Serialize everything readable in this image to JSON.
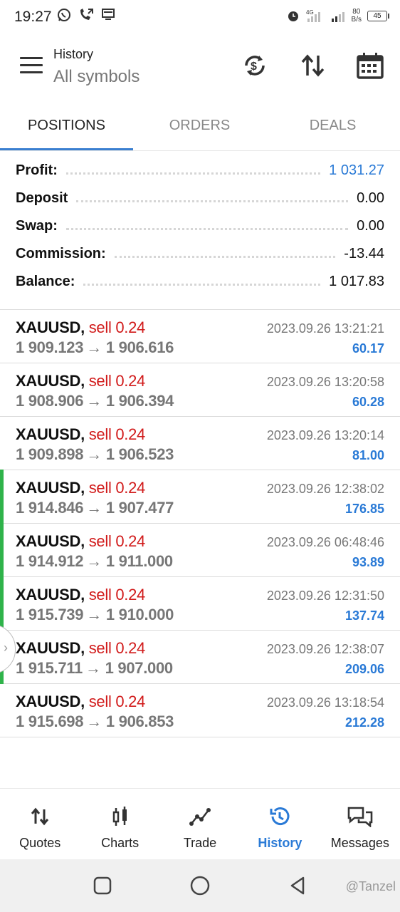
{
  "status_bar": {
    "time": "19:27",
    "net_speed_value": "80",
    "net_speed_unit": "B/s",
    "network": "4G",
    "battery": "45"
  },
  "header": {
    "title": "History",
    "subtitle": "All symbols"
  },
  "tabs": [
    {
      "label": "POSITIONS",
      "active": true
    },
    {
      "label": "ORDERS",
      "active": false
    },
    {
      "label": "DEALS",
      "active": false
    }
  ],
  "summary": {
    "profit_label": "Profit:",
    "profit_value": "1 031.27",
    "deposit_label": "Deposit",
    "deposit_value": "0.00",
    "swap_label": "Swap:",
    "swap_value": "0.00",
    "commission_label": "Commission:",
    "commission_value": "-13.44",
    "balance_label": "Balance:",
    "balance_value": "1 017.83"
  },
  "deals": [
    {
      "symbol": "XAUUSD,",
      "side": "sell 0.24",
      "open_price": "1 909.123",
      "close_price": "1 906.616",
      "time": "2023.09.26 13:21:21",
      "profit": "60.17"
    },
    {
      "symbol": "XAUUSD,",
      "side": "sell 0.24",
      "open_price": "1 908.906",
      "close_price": "1 906.394",
      "time": "2023.09.26 13:20:58",
      "profit": "60.28"
    },
    {
      "symbol": "XAUUSD,",
      "side": "sell 0.24",
      "open_price": "1 909.898",
      "close_price": "1 906.523",
      "time": "2023.09.26 13:20:14",
      "profit": "81.00"
    },
    {
      "symbol": "XAUUSD,",
      "side": "sell 0.24",
      "open_price": "1 914.846",
      "close_price": "1 907.477",
      "time": "2023.09.26 12:38:02",
      "profit": "176.85"
    },
    {
      "symbol": "XAUUSD,",
      "side": "sell 0.24",
      "open_price": "1 914.912",
      "close_price": "1 911.000",
      "time": "2023.09.26 06:48:46",
      "profit": "93.89"
    },
    {
      "symbol": "XAUUSD,",
      "side": "sell 0.24",
      "open_price": "1 915.739",
      "close_price": "1 910.000",
      "time": "2023.09.26 12:31:50",
      "profit": "137.74"
    },
    {
      "symbol": "XAUUSD,",
      "side": "sell 0.24",
      "open_price": "1 915.711",
      "close_price": "1 907.000",
      "time": "2023.09.26 12:38:07",
      "profit": "209.06"
    },
    {
      "symbol": "XAUUSD,",
      "side": "sell 0.24",
      "open_price": "1 915.698",
      "close_price": "1 906.853",
      "time": "2023.09.26 13:18:54",
      "profit": "212.28"
    }
  ],
  "price_arrow": "→",
  "bottom_nav": [
    {
      "label": "Quotes",
      "icon": "quotes-icon",
      "active": false
    },
    {
      "label": "Charts",
      "icon": "charts-icon",
      "active": false
    },
    {
      "label": "Trade",
      "icon": "trade-icon",
      "active": false
    },
    {
      "label": "History",
      "icon": "history-icon",
      "active": true
    },
    {
      "label": "Messages",
      "icon": "messages-icon",
      "active": false
    }
  ],
  "watermark": "@Tanzel",
  "colors": {
    "accent": "#2a7ad6",
    "sell": "#d11a1a",
    "green_marker": "#2fb34a"
  }
}
